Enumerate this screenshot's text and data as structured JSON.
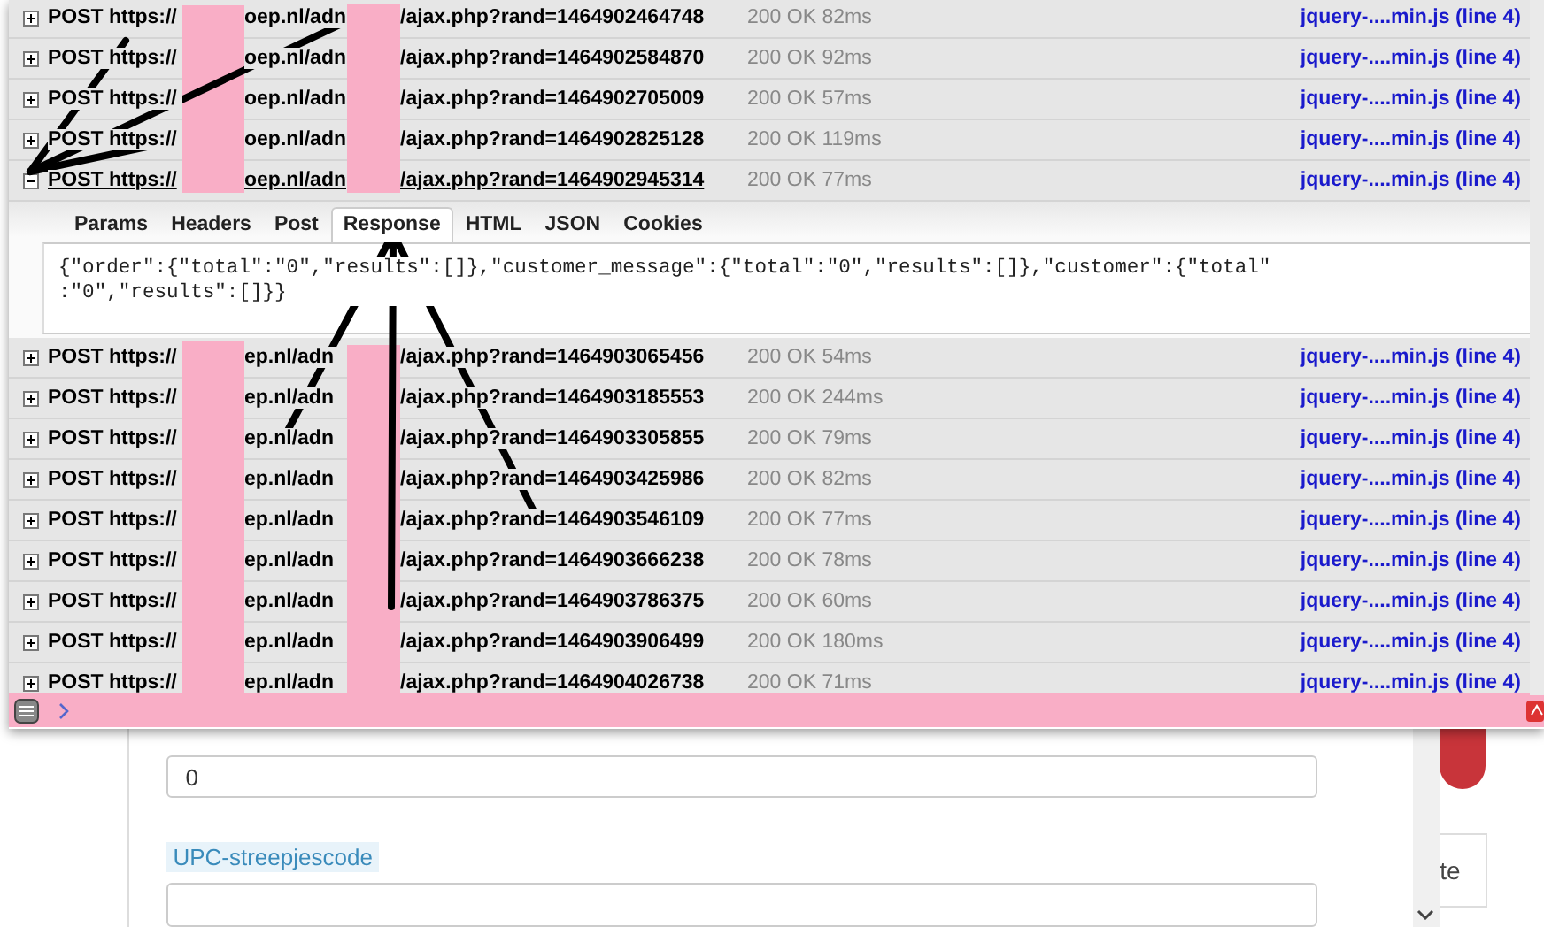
{
  "requests": [
    {
      "method": "POST",
      "url_start": "https://",
      "url_middle": "oep.nl/adn",
      "url_end": "/ajax.php?rand=1464902464748",
      "status": "200 OK 82ms",
      "source": "jquery-....min.js (line 4)",
      "expanded": false
    },
    {
      "method": "POST",
      "url_start": "https://",
      "url_middle": "oep.nl/adn",
      "url_end": "/ajax.php?rand=1464902584870",
      "status": "200 OK 92ms",
      "source": "jquery-....min.js (line 4)",
      "expanded": false
    },
    {
      "method": "POST",
      "url_start": "https://",
      "url_middle": "oep.nl/adn",
      "url_end": "/ajax.php?rand=1464902705009",
      "status": "200 OK 57ms",
      "source": "jquery-....min.js (line 4)",
      "expanded": false
    },
    {
      "method": "POST",
      "url_start": "https://",
      "url_middle": "oep.nl/adn",
      "url_end": "/ajax.php?rand=1464902825128",
      "status": "200 OK 119ms",
      "source": "jquery-....min.js (line 4)",
      "expanded": false
    },
    {
      "method": "POST",
      "url_start": "https://",
      "url_middle": "oep.nl/adn",
      "url_end": "/ajax.php?rand=1464902945314",
      "status": "200 OK 77ms",
      "source": "jquery-....min.js (line 4)",
      "expanded": true,
      "detail": {
        "tabs": [
          {
            "label": "Params",
            "selected": false
          },
          {
            "label": "Headers",
            "selected": false
          },
          {
            "label": "Post",
            "selected": false
          },
          {
            "label": "Response",
            "selected": true
          },
          {
            "label": "HTML",
            "selected": false
          },
          {
            "label": "JSON",
            "selected": false
          },
          {
            "label": "Cookies",
            "selected": false
          }
        ],
        "response_lines": [
          "{\"order\":{\"total\":\"0\",\"results\":[]},\"customer_message\":{\"total\":\"0\",\"results\":[]},\"customer\":{\"total\"",
          ":\"0\",\"results\":[]}}"
        ]
      }
    },
    {
      "method": "POST",
      "url_start": "https://",
      "url_middle": "ep.nl/adn",
      "url_end": "/ajax.php?rand=1464903065456",
      "status": "200 OK 54ms",
      "source": "jquery-....min.js (line 4)",
      "expanded": false
    },
    {
      "method": "POST",
      "url_start": "https://",
      "url_middle": "ep.nl/adn",
      "url_end": "/ajax.php?rand=1464903185553",
      "status": "200 OK 244ms",
      "source": "jquery-....min.js (line 4)",
      "expanded": false
    },
    {
      "method": "POST",
      "url_start": "https://",
      "url_middle": "ep.nl/adn",
      "url_end": "/ajax.php?rand=1464903305855",
      "status": "200 OK 79ms",
      "source": "jquery-....min.js (line 4)",
      "expanded": false
    },
    {
      "method": "POST",
      "url_start": "https://",
      "url_middle": "ep.nl/adn",
      "url_end": "/ajax.php?rand=1464903425986",
      "status": "200 OK 82ms",
      "source": "jquery-....min.js (line 4)",
      "expanded": false
    },
    {
      "method": "POST",
      "url_start": "https://",
      "url_middle": "ep.nl/adn",
      "url_end": "/ajax.php?rand=1464903546109",
      "status": "200 OK 77ms",
      "source": "jquery-....min.js (line 4)",
      "expanded": false
    },
    {
      "method": "POST",
      "url_start": "https://",
      "url_middle": "ep.nl/adn",
      "url_end": "/ajax.php?rand=1464903666238",
      "status": "200 OK 78ms",
      "source": "jquery-....min.js (line 4)",
      "expanded": false
    },
    {
      "method": "POST",
      "url_start": "https://",
      "url_middle": "ep.nl/adn",
      "url_end": "/ajax.php?rand=1464903786375",
      "status": "200 OK 60ms",
      "source": "jquery-....min.js (line 4)",
      "expanded": false
    },
    {
      "method": "POST",
      "url_start": "https://",
      "url_middle": "ep.nl/adn",
      "url_end": "/ajax.php?rand=1464903906499",
      "status": "200 OK 180ms",
      "source": "jquery-....min.js (line 4)",
      "expanded": false
    },
    {
      "method": "POST",
      "url_start": "https://",
      "url_middle": "ep.nl/adn",
      "url_end": "/ajax.php?rand=1464904026738",
      "status": "200 OK 71ms",
      "source": "jquery-....min.js (line 4)",
      "expanded": false
    }
  ],
  "page_form": {
    "ean_value": "0",
    "upc_label": "UPC-streepjescode",
    "side_text": "te"
  }
}
